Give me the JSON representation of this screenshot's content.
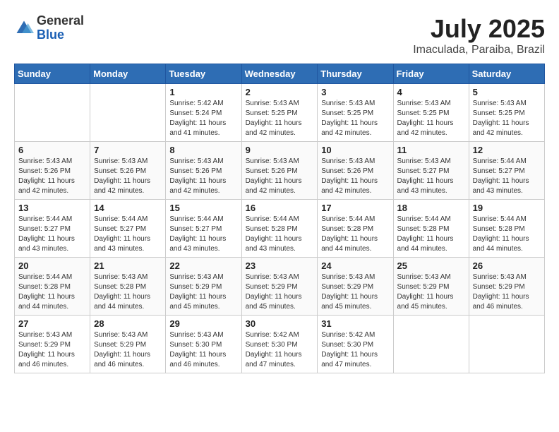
{
  "header": {
    "logo_general": "General",
    "logo_blue": "Blue",
    "month_year": "July 2025",
    "location": "Imaculada, Paraiba, Brazil"
  },
  "weekdays": [
    "Sunday",
    "Monday",
    "Tuesday",
    "Wednesday",
    "Thursday",
    "Friday",
    "Saturday"
  ],
  "weeks": [
    [
      {
        "num": "",
        "sunrise": "",
        "sunset": "",
        "daylight": ""
      },
      {
        "num": "",
        "sunrise": "",
        "sunset": "",
        "daylight": ""
      },
      {
        "num": "1",
        "sunrise": "Sunrise: 5:42 AM",
        "sunset": "Sunset: 5:24 PM",
        "daylight": "Daylight: 11 hours and 41 minutes."
      },
      {
        "num": "2",
        "sunrise": "Sunrise: 5:43 AM",
        "sunset": "Sunset: 5:25 PM",
        "daylight": "Daylight: 11 hours and 42 minutes."
      },
      {
        "num": "3",
        "sunrise": "Sunrise: 5:43 AM",
        "sunset": "Sunset: 5:25 PM",
        "daylight": "Daylight: 11 hours and 42 minutes."
      },
      {
        "num": "4",
        "sunrise": "Sunrise: 5:43 AM",
        "sunset": "Sunset: 5:25 PM",
        "daylight": "Daylight: 11 hours and 42 minutes."
      },
      {
        "num": "5",
        "sunrise": "Sunrise: 5:43 AM",
        "sunset": "Sunset: 5:25 PM",
        "daylight": "Daylight: 11 hours and 42 minutes."
      }
    ],
    [
      {
        "num": "6",
        "sunrise": "Sunrise: 5:43 AM",
        "sunset": "Sunset: 5:26 PM",
        "daylight": "Daylight: 11 hours and 42 minutes."
      },
      {
        "num": "7",
        "sunrise": "Sunrise: 5:43 AM",
        "sunset": "Sunset: 5:26 PM",
        "daylight": "Daylight: 11 hours and 42 minutes."
      },
      {
        "num": "8",
        "sunrise": "Sunrise: 5:43 AM",
        "sunset": "Sunset: 5:26 PM",
        "daylight": "Daylight: 11 hours and 42 minutes."
      },
      {
        "num": "9",
        "sunrise": "Sunrise: 5:43 AM",
        "sunset": "Sunset: 5:26 PM",
        "daylight": "Daylight: 11 hours and 42 minutes."
      },
      {
        "num": "10",
        "sunrise": "Sunrise: 5:43 AM",
        "sunset": "Sunset: 5:26 PM",
        "daylight": "Daylight: 11 hours and 42 minutes."
      },
      {
        "num": "11",
        "sunrise": "Sunrise: 5:43 AM",
        "sunset": "Sunset: 5:27 PM",
        "daylight": "Daylight: 11 hours and 43 minutes."
      },
      {
        "num": "12",
        "sunrise": "Sunrise: 5:44 AM",
        "sunset": "Sunset: 5:27 PM",
        "daylight": "Daylight: 11 hours and 43 minutes."
      }
    ],
    [
      {
        "num": "13",
        "sunrise": "Sunrise: 5:44 AM",
        "sunset": "Sunset: 5:27 PM",
        "daylight": "Daylight: 11 hours and 43 minutes."
      },
      {
        "num": "14",
        "sunrise": "Sunrise: 5:44 AM",
        "sunset": "Sunset: 5:27 PM",
        "daylight": "Daylight: 11 hours and 43 minutes."
      },
      {
        "num": "15",
        "sunrise": "Sunrise: 5:44 AM",
        "sunset": "Sunset: 5:27 PM",
        "daylight": "Daylight: 11 hours and 43 minutes."
      },
      {
        "num": "16",
        "sunrise": "Sunrise: 5:44 AM",
        "sunset": "Sunset: 5:28 PM",
        "daylight": "Daylight: 11 hours and 43 minutes."
      },
      {
        "num": "17",
        "sunrise": "Sunrise: 5:44 AM",
        "sunset": "Sunset: 5:28 PM",
        "daylight": "Daylight: 11 hours and 44 minutes."
      },
      {
        "num": "18",
        "sunrise": "Sunrise: 5:44 AM",
        "sunset": "Sunset: 5:28 PM",
        "daylight": "Daylight: 11 hours and 44 minutes."
      },
      {
        "num": "19",
        "sunrise": "Sunrise: 5:44 AM",
        "sunset": "Sunset: 5:28 PM",
        "daylight": "Daylight: 11 hours and 44 minutes."
      }
    ],
    [
      {
        "num": "20",
        "sunrise": "Sunrise: 5:44 AM",
        "sunset": "Sunset: 5:28 PM",
        "daylight": "Daylight: 11 hours and 44 minutes."
      },
      {
        "num": "21",
        "sunrise": "Sunrise: 5:43 AM",
        "sunset": "Sunset: 5:28 PM",
        "daylight": "Daylight: 11 hours and 44 minutes."
      },
      {
        "num": "22",
        "sunrise": "Sunrise: 5:43 AM",
        "sunset": "Sunset: 5:29 PM",
        "daylight": "Daylight: 11 hours and 45 minutes."
      },
      {
        "num": "23",
        "sunrise": "Sunrise: 5:43 AM",
        "sunset": "Sunset: 5:29 PM",
        "daylight": "Daylight: 11 hours and 45 minutes."
      },
      {
        "num": "24",
        "sunrise": "Sunrise: 5:43 AM",
        "sunset": "Sunset: 5:29 PM",
        "daylight": "Daylight: 11 hours and 45 minutes."
      },
      {
        "num": "25",
        "sunrise": "Sunrise: 5:43 AM",
        "sunset": "Sunset: 5:29 PM",
        "daylight": "Daylight: 11 hours and 45 minutes."
      },
      {
        "num": "26",
        "sunrise": "Sunrise: 5:43 AM",
        "sunset": "Sunset: 5:29 PM",
        "daylight": "Daylight: 11 hours and 46 minutes."
      }
    ],
    [
      {
        "num": "27",
        "sunrise": "Sunrise: 5:43 AM",
        "sunset": "Sunset: 5:29 PM",
        "daylight": "Daylight: 11 hours and 46 minutes."
      },
      {
        "num": "28",
        "sunrise": "Sunrise: 5:43 AM",
        "sunset": "Sunset: 5:29 PM",
        "daylight": "Daylight: 11 hours and 46 minutes."
      },
      {
        "num": "29",
        "sunrise": "Sunrise: 5:43 AM",
        "sunset": "Sunset: 5:30 PM",
        "daylight": "Daylight: 11 hours and 46 minutes."
      },
      {
        "num": "30",
        "sunrise": "Sunrise: 5:42 AM",
        "sunset": "Sunset: 5:30 PM",
        "daylight": "Daylight: 11 hours and 47 minutes."
      },
      {
        "num": "31",
        "sunrise": "Sunrise: 5:42 AM",
        "sunset": "Sunset: 5:30 PM",
        "daylight": "Daylight: 11 hours and 47 minutes."
      },
      {
        "num": "",
        "sunrise": "",
        "sunset": "",
        "daylight": ""
      },
      {
        "num": "",
        "sunrise": "",
        "sunset": "",
        "daylight": ""
      }
    ]
  ]
}
